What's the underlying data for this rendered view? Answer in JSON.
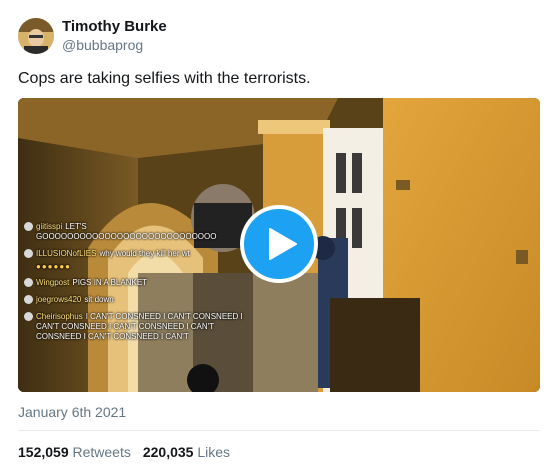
{
  "author": {
    "name": "Timothy Burke",
    "handle": "@bubbaprog"
  },
  "tweet": {
    "text": "Cops are taking selfies with the terrorists.",
    "date": "January 6th 2021"
  },
  "media": {
    "chat": [
      {
        "user": "giitisspi",
        "text": "LET'S GOOOOOOOOOOOOOOOOOOOOOOOOOOOO"
      },
      {
        "user": "ILLUSIONofLIES",
        "text": "why would they kill her wt"
      },
      {
        "user": "Wingpost",
        "text": "PIGS IN A BLANKET"
      },
      {
        "user": "joegrows420",
        "text": "sit down"
      },
      {
        "user": "Cheirisophus",
        "text": "I CAN'T CONSNEED I CAN'T CONSNEED I CAN'T CONSNEED I CAN'T CONSNEED I CAN'T CONSNEED I CAN'T CONSNEED I CAN'T"
      }
    ],
    "emoji_row": "●●●●●●",
    "play_color": "#1da1f2"
  },
  "stats": {
    "retweets_count": "152,059",
    "retweets_label": "Retweets",
    "likes_count": "220,035",
    "likes_label": "Likes"
  }
}
